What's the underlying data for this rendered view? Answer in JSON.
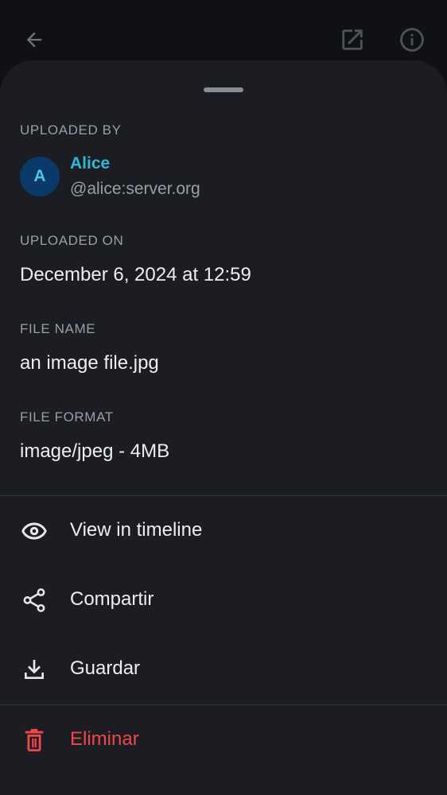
{
  "topbar": {
    "back_icon": "arrow-back-icon",
    "open_icon": "open-external-icon",
    "info_icon": "info-icon"
  },
  "details": {
    "uploaded_by_label": "UPLOADED BY",
    "uploader": {
      "avatar_initial": "A",
      "name": "Alice",
      "user_id": "@alice:server.org"
    },
    "uploaded_on_label": "UPLOADED ON",
    "uploaded_on_value": "December 6, 2024 at 12:59",
    "file_name_label": "FILE NAME",
    "file_name_value": "an image file.jpg",
    "file_format_label": "FILE FORMAT",
    "file_format_value": "image/jpeg - 4MB"
  },
  "actions": [
    {
      "label": "View in timeline",
      "icon": "eye-icon"
    },
    {
      "label": "Compartir",
      "icon": "share-icon"
    },
    {
      "label": "Guardar",
      "icon": "download-icon"
    },
    {
      "label": "Eliminar",
      "icon": "trash-icon"
    }
  ],
  "colors": {
    "accent": "#2fb8d6",
    "danger": "#f04848",
    "sheet_bg": "#1b1d22",
    "avatar_bg": "#0b3a6a"
  }
}
